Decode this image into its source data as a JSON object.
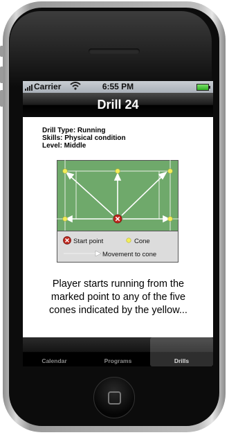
{
  "status_bar": {
    "carrier": "Carrier",
    "time": "6:55 PM"
  },
  "nav": {
    "title": "Drill 24"
  },
  "drill": {
    "type_line": "Drill Type: Running",
    "skills_line": "Skills: Physical condition",
    "level_line": "Level: Middle"
  },
  "legend": {
    "start_label": "Start point",
    "cone_label": "Cone",
    "movement_label": "Movement to cone"
  },
  "description": "Player starts running from the marked point to any of the five cones indicated by the yellow...",
  "tabs": [
    {
      "label": "Calendar"
    },
    {
      "label": "Programs"
    },
    {
      "label": "Drills"
    }
  ],
  "colors": {
    "court_green": "#6fa96b",
    "legend_bg": "#dcdcdc",
    "start_red": "#c0281e",
    "cone_yellow": "#f2ee5a"
  }
}
